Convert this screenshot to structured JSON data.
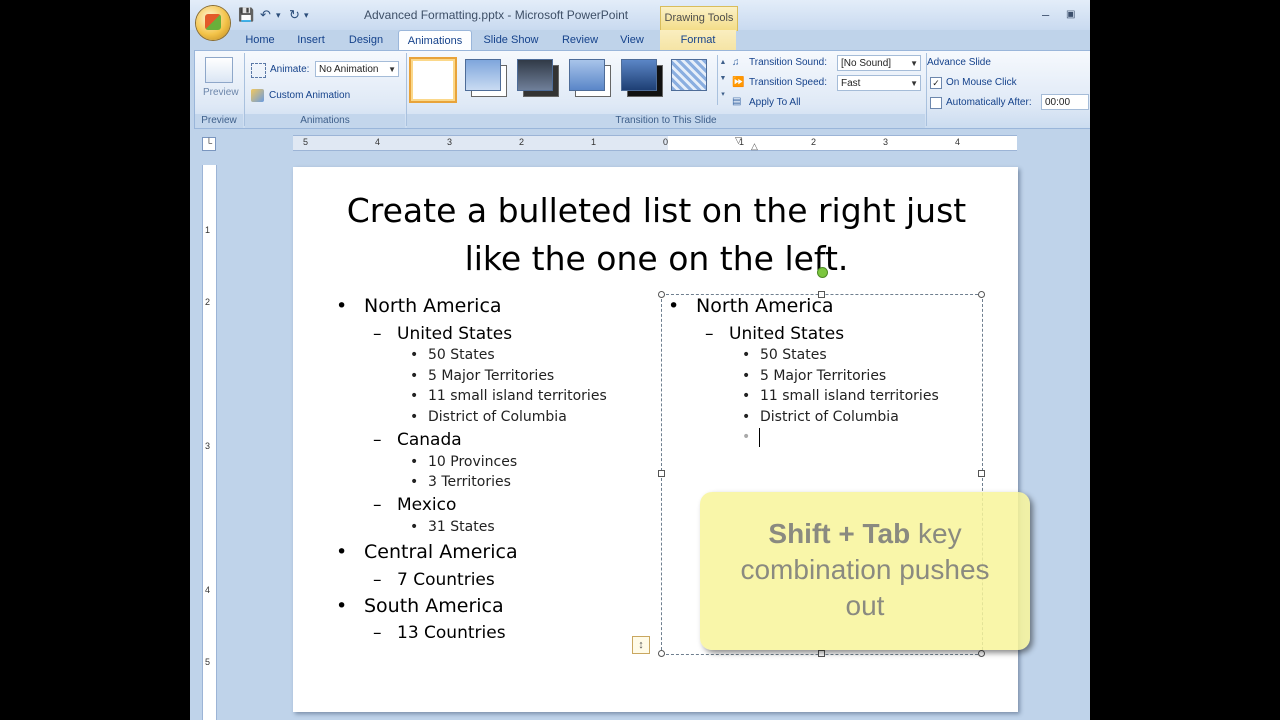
{
  "window": {
    "title": "Advanced Formatting.pptx - Microsoft PowerPoint",
    "context_tools": "Drawing Tools"
  },
  "tabs": [
    "Home",
    "Insert",
    "Design",
    "Animations",
    "Slide Show",
    "Review",
    "View",
    "Format"
  ],
  "active_tab": "Animations",
  "ribbon": {
    "preview": {
      "label": "Preview",
      "group": "Preview"
    },
    "animations": {
      "animate_label": "Animate:",
      "animate_value": "No Animation",
      "custom_animation": "Custom Animation",
      "group": "Animations"
    },
    "transition": {
      "group": "Transition to This Slide",
      "sound_label": "Transition Sound:",
      "sound_value": "[No Sound]",
      "speed_label": "Transition Speed:",
      "speed_value": "Fast",
      "apply_all": "Apply To All"
    },
    "advance": {
      "title": "Advance Slide",
      "on_mouse_click": "On Mouse Click",
      "on_mouse_click_checked": true,
      "auto_after": "Automatically After:",
      "auto_after_checked": false,
      "auto_after_value": "00:00"
    }
  },
  "ruler": {
    "h_numbers": [
      "5",
      "4",
      "3",
      "2",
      "1",
      "0",
      "1",
      "2",
      "3",
      "4"
    ],
    "v_numbers": [
      "1",
      "2",
      "3",
      "4",
      "5"
    ]
  },
  "slide": {
    "title_line1": "Create a bulleted list on the right just",
    "title_line2": "like the one on the left.",
    "left_list": [
      {
        "level": 1,
        "text": "North America"
      },
      {
        "level": 2,
        "text": "United States"
      },
      {
        "level": 3,
        "text": "50 States"
      },
      {
        "level": 3,
        "text": "5 Major Territories"
      },
      {
        "level": 3,
        "text": "11 small island territories"
      },
      {
        "level": 3,
        "text": "District of Columbia"
      },
      {
        "level": 2,
        "text": "Canada"
      },
      {
        "level": 3,
        "text": "10 Provinces"
      },
      {
        "level": 3,
        "text": "3 Territories"
      },
      {
        "level": 2,
        "text": "Mexico"
      },
      {
        "level": 3,
        "text": "31 States"
      },
      {
        "level": 1,
        "text": "Central America"
      },
      {
        "level": 2,
        "text": "7 Countries"
      },
      {
        "level": 1,
        "text": "South America"
      },
      {
        "level": 2,
        "text": "13 Countries"
      }
    ],
    "right_list": [
      {
        "level": 1,
        "text": "North America"
      },
      {
        "level": 2,
        "text": "United States"
      },
      {
        "level": 3,
        "text": "50 States"
      },
      {
        "level": 3,
        "text": "5 Major Territories"
      },
      {
        "level": 3,
        "text": "11 small island territories"
      },
      {
        "level": 3,
        "text": "District of Columbia"
      },
      {
        "level": 3,
        "text": ""
      }
    ]
  },
  "callout": {
    "bold_part": "Shift + Tab",
    "line1_rest": " key",
    "line2": "combination pushes",
    "line3": "out"
  }
}
